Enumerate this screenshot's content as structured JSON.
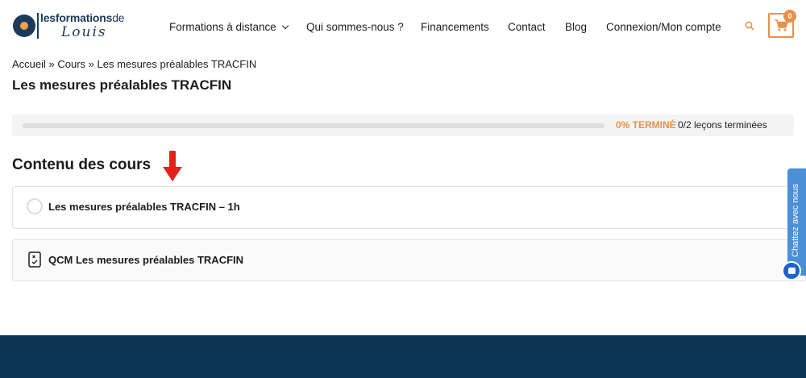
{
  "brand": {
    "logo_top_bold": "lesformations",
    "logo_top_light": "de",
    "logo_bottom": "Louis"
  },
  "nav": {
    "items": [
      {
        "label": "Formations à distance",
        "has_dropdown": true
      },
      {
        "label": "Qui sommes-nous ?"
      },
      {
        "label": "Financements"
      },
      {
        "label": "Contact"
      },
      {
        "label": "Blog"
      },
      {
        "label": "Connexion/Mon compte"
      }
    ],
    "cart_count": "0"
  },
  "breadcrumb": "Accueil » Cours » Les mesures préalables TRACFIN",
  "page_title": "Les mesures préalables TRACFIN",
  "progress": {
    "percent_label": "0% TERMINÉ",
    "steps_label": "0/2 leçons terminées",
    "fraction": 0
  },
  "course_content": {
    "title": "Contenu des cours",
    "lessons": [
      {
        "label": "Les mesures préalables TRACFIN – 1h",
        "type": "lesson"
      },
      {
        "label": "QCM Les mesures préalables TRACFIN",
        "type": "quiz"
      }
    ]
  },
  "chat": {
    "label": "Chattez avec nous"
  },
  "colors": {
    "brand_navy": "#1c3b5a",
    "accent_orange": "#e8914a",
    "footer": "#0a3354",
    "chat_blue": "#4a90d9"
  }
}
